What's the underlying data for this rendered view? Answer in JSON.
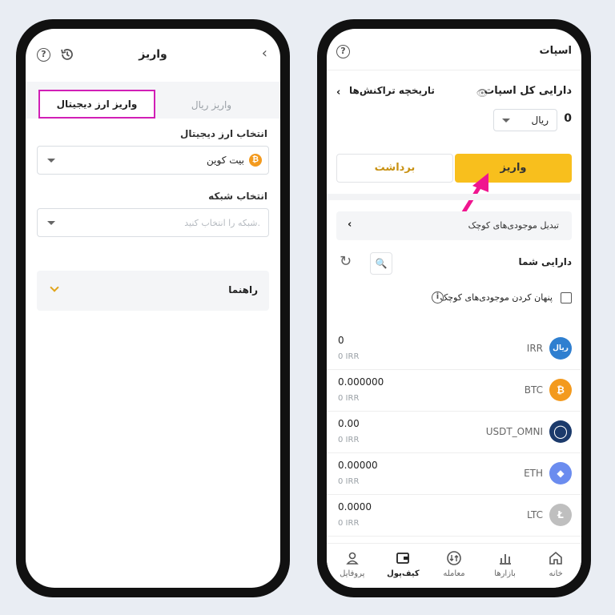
{
  "left": {
    "title": "واریز",
    "back_glyph": "‹",
    "tabs": {
      "rial": "واریز ریال",
      "crypto": "واریز ارز دیجیتال"
    },
    "select_crypto_label": "انتخاب ارز دیجیتال",
    "selected_coin": "بیت کوین",
    "select_network_label": "انتخاب شبکه",
    "network_placeholder": "شبکه را انتخاب کنید.",
    "guide": "راهنما",
    "highlight_color": "#d11fb6"
  },
  "right": {
    "title": "اسپات",
    "total_assets_label": "دارایی کل اسپات",
    "transaction_history": "تاریخچه تراکنش‌ها",
    "balance": "0",
    "currency": "ریال",
    "deposit": "واریز",
    "withdraw": "برداشت",
    "convert_small": "تبدیل موجودی‌های کوچک",
    "your_assets": "دارایی شما",
    "hide_small": "پنهان کردن موجودی‌های کوچک",
    "accent_color": "#f8bf1d",
    "arrow_color": "#f0158f",
    "assets": [
      {
        "symbol": "IRR",
        "amount": "0",
        "irr": "0 IRR",
        "icon": "ریال",
        "color": "#2f7fd0"
      },
      {
        "symbol": "BTC",
        "amount": "0.000000",
        "irr": "0 IRR",
        "icon": "₿",
        "color": "#f39a1e"
      },
      {
        "symbol": "USDT_OMNI",
        "amount": "0.00",
        "irr": "0 IRR",
        "icon": "◯",
        "color": "#1b3a6b"
      },
      {
        "symbol": "ETH",
        "amount": "0.00000",
        "irr": "0 IRR",
        "icon": "◆",
        "color": "#6b8cef"
      },
      {
        "symbol": "LTC",
        "amount": "0.0000",
        "irr": "0 IRR",
        "icon": "Ł",
        "color": "#bfbfbf"
      }
    ],
    "nav": [
      {
        "label": "خانه",
        "icon": "home-icon",
        "active": false
      },
      {
        "label": "بازارها",
        "icon": "chart-icon",
        "active": false
      },
      {
        "label": "معامله",
        "icon": "exchange-icon",
        "active": false
      },
      {
        "label": "کیف‌پول",
        "icon": "wallet-icon",
        "active": true
      },
      {
        "label": "پروفایل",
        "icon": "user-icon",
        "active": false
      }
    ]
  }
}
